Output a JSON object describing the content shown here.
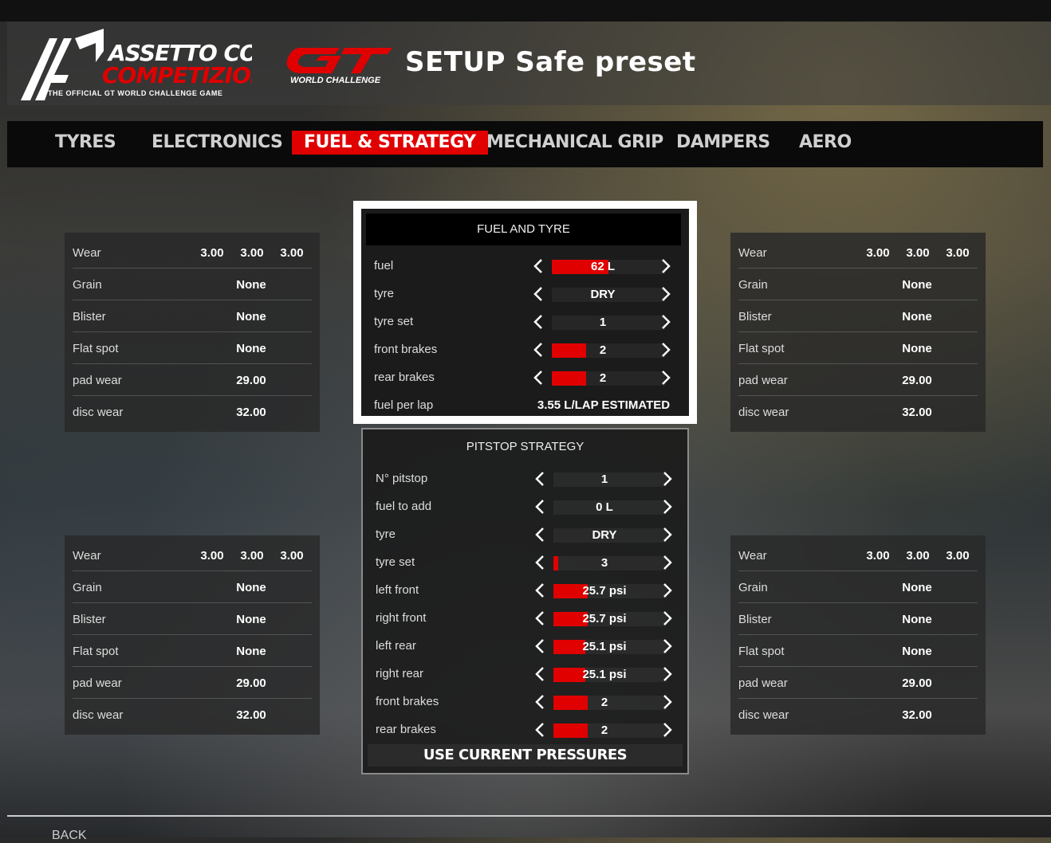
{
  "header": {
    "acc_logo_text": "ASSETTO CORSA COMPETIZIONE THE OFFICIAL GT WORLD CHALLENGE GAME",
    "gt_logo_text": "GT WORLD CHALLENGE",
    "title": "SETUP Safe preset"
  },
  "tabs": [
    {
      "label": "TYRES",
      "active": false
    },
    {
      "label": "ELECTRONICS",
      "active": false
    },
    {
      "label": "FUEL & STRATEGY",
      "active": true
    },
    {
      "label": "MECHANICAL GRIP",
      "active": false
    },
    {
      "label": "DAMPERS",
      "active": false
    },
    {
      "label": "AERO",
      "active": false
    }
  ],
  "tyre_panels": [
    {
      "wear_label": "Wear",
      "wear": [
        "3.00",
        "3.00",
        "3.00"
      ],
      "grain_label": "Grain",
      "grain": "None",
      "blister_label": "Blister",
      "blister": "None",
      "flat_label": "Flat spot",
      "flat": "None",
      "pad_label": "pad wear",
      "pad": "29.00",
      "disc_label": "disc wear",
      "disc": "32.00"
    },
    {
      "wear_label": "Wear",
      "wear": [
        "3.00",
        "3.00",
        "3.00"
      ],
      "grain_label": "Grain",
      "grain": "None",
      "blister_label": "Blister",
      "blister": "None",
      "flat_label": "Flat spot",
      "flat": "None",
      "pad_label": "pad wear",
      "pad": "29.00",
      "disc_label": "disc wear",
      "disc": "32.00"
    },
    {
      "wear_label": "Wear",
      "wear": [
        "3.00",
        "3.00",
        "3.00"
      ],
      "grain_label": "Grain",
      "grain": "None",
      "blister_label": "Blister",
      "blister": "None",
      "flat_label": "Flat spot",
      "flat": "None",
      "pad_label": "pad wear",
      "pad": "29.00",
      "disc_label": "disc wear",
      "disc": "32.00"
    },
    {
      "wear_label": "Wear",
      "wear": [
        "3.00",
        "3.00",
        "3.00"
      ],
      "grain_label": "Grain",
      "grain": "None",
      "blister_label": "Blister",
      "blister": "None",
      "flat_label": "Flat spot",
      "flat": "None",
      "pad_label": "pad wear",
      "pad": "29.00",
      "disc_label": "disc wear",
      "disc": "32.00"
    }
  ],
  "fuel_tyre": {
    "title": "FUEL AND TYRE",
    "rows": [
      {
        "label": "fuel",
        "value": "62 L",
        "fill": 0.5
      },
      {
        "label": "tyre",
        "value": "DRY",
        "fill": 0
      },
      {
        "label": "tyre set",
        "value": "1",
        "fill": 0
      },
      {
        "label": "front brakes",
        "value": "2",
        "fill": 0.3
      },
      {
        "label": "rear brakes",
        "value": "2",
        "fill": 0.3
      }
    ],
    "fuel_per_lap_label": "fuel per lap",
    "fuel_per_lap_value": "3.55 L/LAP ESTIMATED"
  },
  "pitstop": {
    "title": "PITSTOP STRATEGY",
    "rows": [
      {
        "label": "N° pitstop",
        "value": "1",
        "fill": 0
      },
      {
        "label": "fuel to add",
        "value": "0 L",
        "fill": 0
      },
      {
        "label": "tyre",
        "value": "DRY",
        "fill": 0
      },
      {
        "label": "tyre set",
        "value": "3",
        "fill": 0.04
      },
      {
        "label": "left front",
        "value": "25.7 psi",
        "fill": 0.3
      },
      {
        "label": "right front",
        "value": "25.7 psi",
        "fill": 0.3
      },
      {
        "label": "left rear",
        "value": "25.1 psi",
        "fill": 0.28
      },
      {
        "label": "right rear",
        "value": "25.1 psi",
        "fill": 0.28
      },
      {
        "label": "front brakes",
        "value": "2",
        "fill": 0.3
      },
      {
        "label": "rear brakes",
        "value": "2",
        "fill": 0.3
      }
    ],
    "use_button": "USE CURRENT PRESSURES"
  },
  "footer": {
    "back": "BACK"
  },
  "colors": {
    "accent": "#e00000",
    "panel": "#282828"
  }
}
